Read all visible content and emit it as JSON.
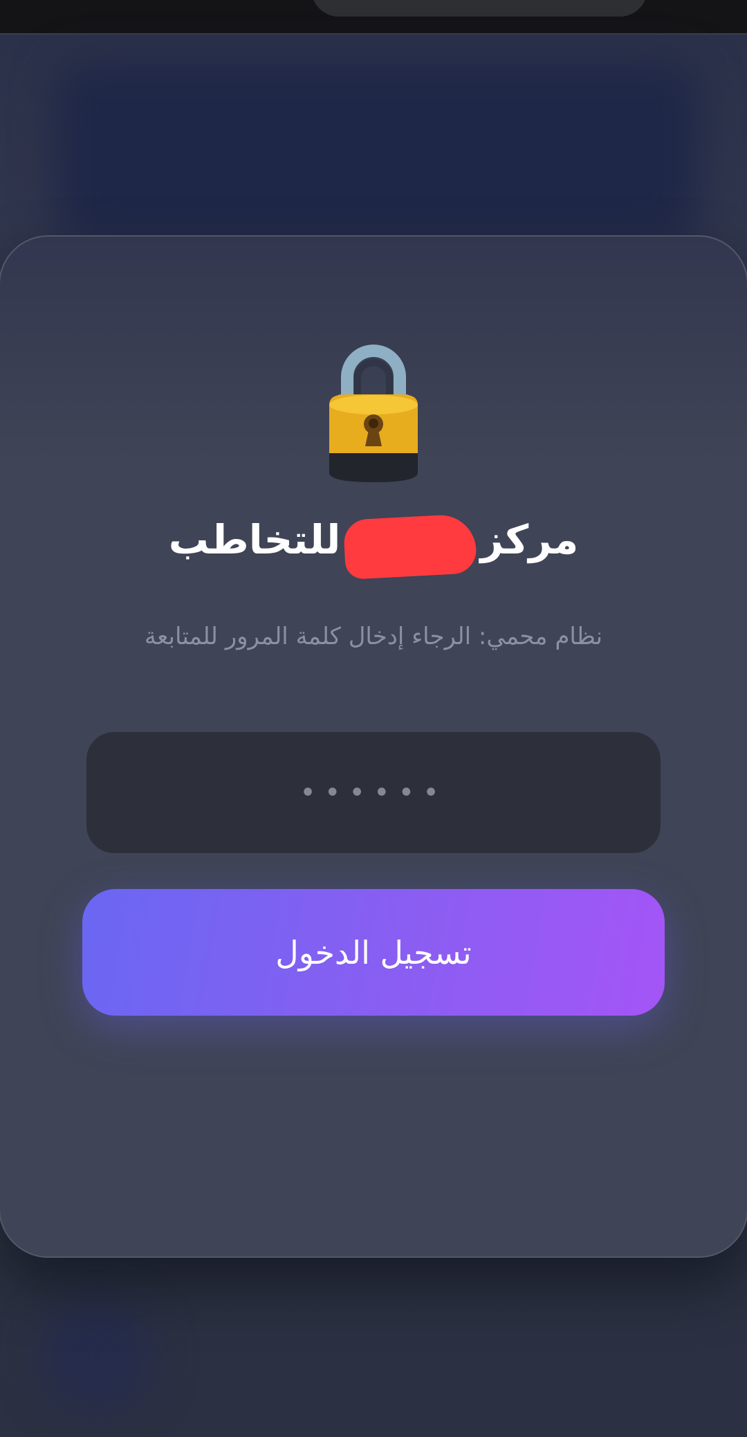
{
  "app": {
    "accent_color": "#6a67f3",
    "accent_color_end": "#a455f6",
    "redaction_color": "#ff3b3f"
  },
  "login": {
    "icon": "lock-icon",
    "title_prefix": "مركز",
    "title_suffix": "للتخاطب",
    "subtitle": "نظام محمي: الرجاء إدخال كلمة المرور للمتابعة",
    "password_placeholder": "••••••",
    "button_label": "تسجيل الدخول"
  }
}
